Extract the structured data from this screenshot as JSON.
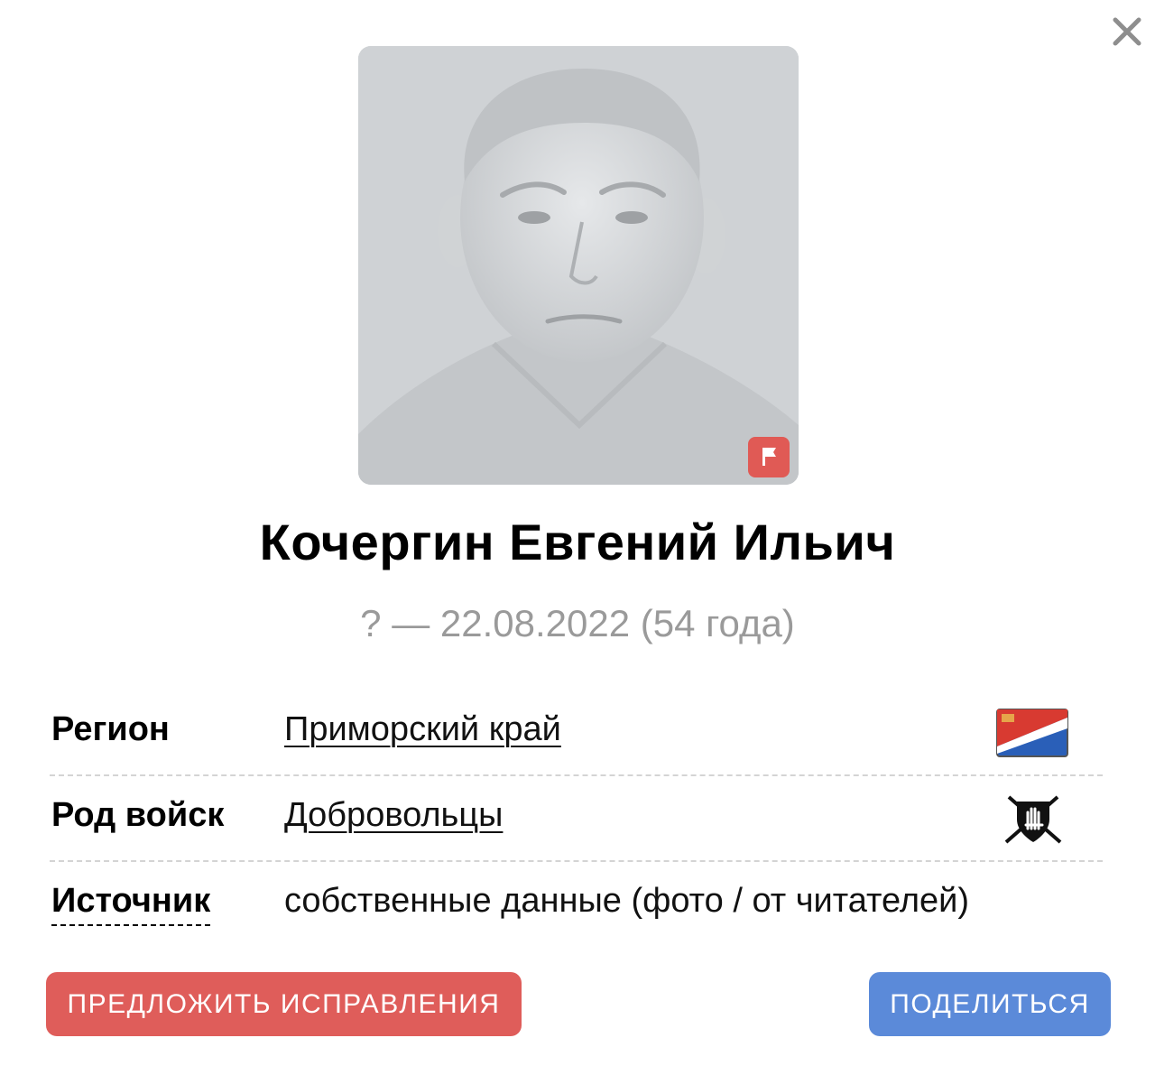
{
  "dialog": {
    "close_icon": "close-icon"
  },
  "person": {
    "photo_icon": "portrait-photo",
    "flag_icon": "flag-icon",
    "name": "Кочергин Евгений Ильич",
    "dates": "? — 22.08.2022 (54 года)"
  },
  "info": {
    "rows": [
      {
        "label": "Регион",
        "value": "Приморский край",
        "icon": "region-flag-icon"
      },
      {
        "label": "Род войск",
        "value": "Добровольцы",
        "icon": "volunteers-emblem-icon"
      },
      {
        "label": "Источник",
        "value": "собственные данные (фото / от читателей)",
        "icon": ""
      }
    ]
  },
  "actions": {
    "suggest_label": "ПРЕДЛОЖИТЬ ИСПРАВЛЕНИЯ",
    "share_label": "ПОДЕЛИТЬСЯ"
  },
  "colors": {
    "suggest_button": "#df5d5a",
    "share_button": "#5b8ad9",
    "flag_badge": "#e05a55",
    "dates_text": "#9a9a9a"
  }
}
